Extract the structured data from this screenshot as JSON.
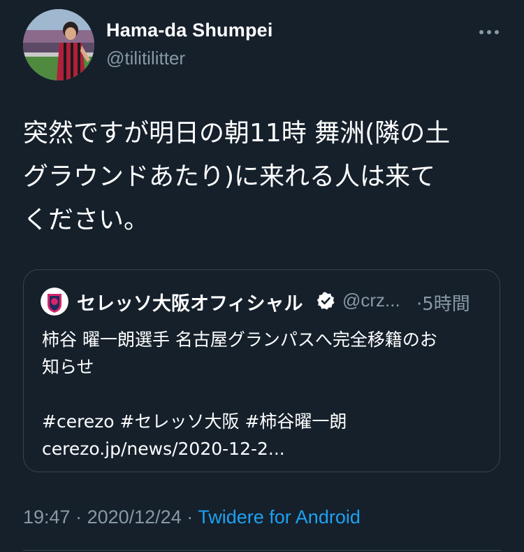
{
  "author": {
    "display_name": "Hama-da Shumpei",
    "handle": "@tilitilitter"
  },
  "tweet": {
    "text_lines": [
      "突然ですが明日の朝11時 舞洲(隣の土",
      "グラウンドあたり)に来れる人は来て",
      "ください。"
    ]
  },
  "quoted_tweet": {
    "display_name": "セレッソ大阪オフィシャル",
    "handle": "@crz...",
    "time": "·5時間",
    "text_line1": "柿谷 曜一朗選手 名古屋グランパスへ完全移籍のお",
    "text_line2": "知らせ",
    "hashtags": "#cerezo #セレッソ大阪 #柿谷曜一朗",
    "link": "cerezo.jp/news/2020-12-2..."
  },
  "meta": {
    "time": "19:47",
    "separator1": " · ",
    "date": "2020/12/24",
    "separator2": " · ",
    "source": "Twidere for Android"
  },
  "icons": {
    "more": "more-horizontal-icon",
    "verified": "verified-badge-icon"
  },
  "colors": {
    "background": "#15202b",
    "text_primary": "#ffffff",
    "text_secondary": "#8899a6",
    "accent": "#1da1f2",
    "border": "#38444d"
  }
}
